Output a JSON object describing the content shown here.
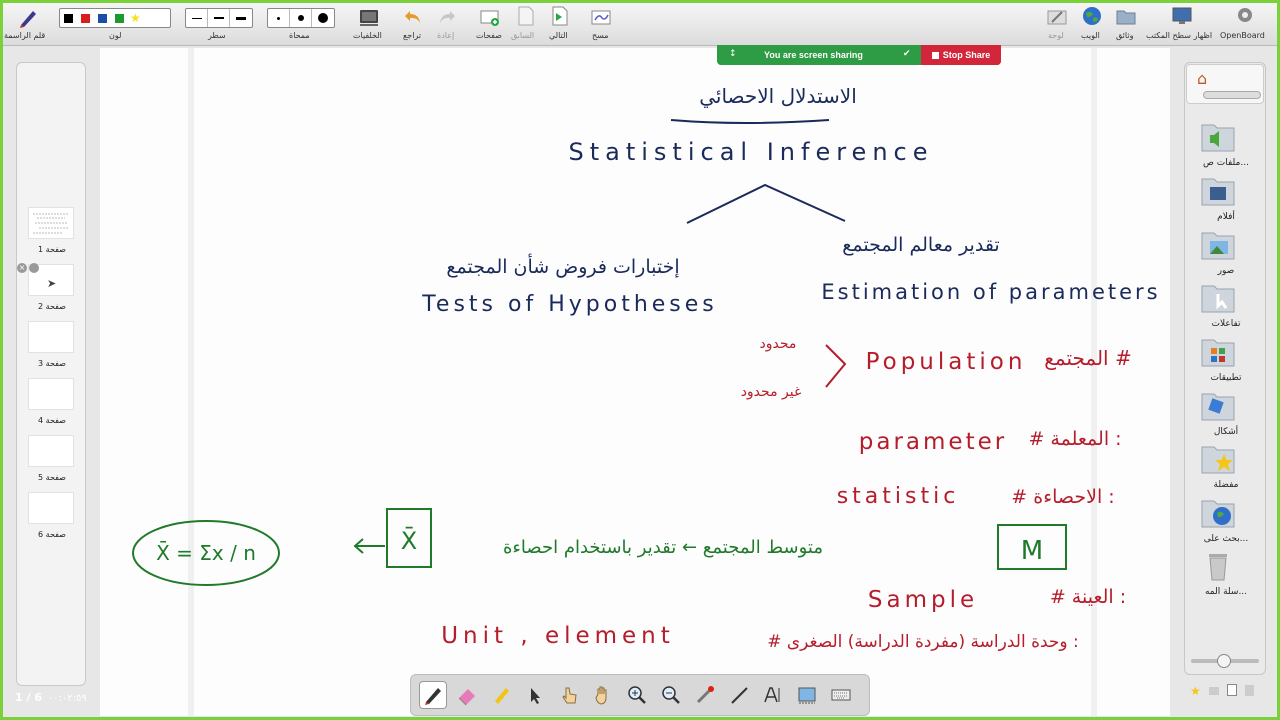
{
  "toolbar": {
    "right_label": "قلم الراسمة",
    "color_label": "لون",
    "line_label": "سطر",
    "eraser_label": "ممحاة",
    "backgrounds_label": "الخلفيات",
    "undo_label": "تراجع",
    "redo_label": "إعادة",
    "pages_label": "صفحات",
    "previous_label": "السابق",
    "next_label": "التالي",
    "clear_label": "مسح",
    "board_label": "لوحة",
    "web_label": "الويب",
    "documents_label": "وثائق",
    "desktop_label": "اظهار سطح المكتب",
    "openboard_label": "OpenBoard",
    "colors": [
      "#000000",
      "#d81e1e",
      "#1c4ea8",
      "#1c9a2b",
      "#f3e21a"
    ]
  },
  "share": {
    "status": "You are screen sharing",
    "stop_label": "Stop Share"
  },
  "thumbnails": [
    {
      "label": "صفحة 1"
    },
    {
      "label": "صفحة 2"
    },
    {
      "label": "صفحة 3"
    },
    {
      "label": "صفحة 4"
    },
    {
      "label": "صفحة 5"
    },
    {
      "label": "صفحة 6"
    }
  ],
  "page_counter": "1 / 6",
  "clock": "٠٠:٠٢:٥٩",
  "library": [
    {
      "label": "ملفات ص...",
      "icon": "audio-folder-icon"
    },
    {
      "label": "أفلام",
      "icon": "movies-folder-icon"
    },
    {
      "label": "صور",
      "icon": "pictures-folder-icon"
    },
    {
      "label": "تفاعلات",
      "icon": "interactive-folder-icon"
    },
    {
      "label": "تطبيقات",
      "icon": "apps-folder-icon"
    },
    {
      "label": "أشكال",
      "icon": "shapes-folder-icon"
    },
    {
      "label": "مفضلة",
      "icon": "favorites-folder-icon"
    },
    {
      "label": "بحث على...",
      "icon": "web-search-icon"
    },
    {
      "label": "سلة المه...",
      "icon": "trash-icon"
    }
  ],
  "board": {
    "title_ar": "الاستدلال الاحصائي",
    "title_en": "Statistical Inference",
    "left_ar": "إختبارات فروض شأن المجتمع",
    "left_en": "Tests of Hypotheses",
    "right_ar": "تقدير معالم المجتمع",
    "right_en": "Estimation of parameters",
    "limited": "محدود",
    "unlimited": "غير محدود",
    "population": "Population",
    "population_ar": "# المجتمع",
    "parameter": "parameter",
    "parameter_ar": ": المعلمة #",
    "statistic": "statistic",
    "statistic_ar": ": الاحصاءة #",
    "mu": "M",
    "arrow_row": "متوسط المجتمع ← تقدير باستخدام احصاءة",
    "xbar": "X̄",
    "formula": "X̄ = Σx / n",
    "sample": "Sample",
    "sample_ar": ": العينة #",
    "unit": "Unit , element",
    "unit_ar": ": وحدة الدراسة (مفردة الدراسة) الصغرى #"
  }
}
